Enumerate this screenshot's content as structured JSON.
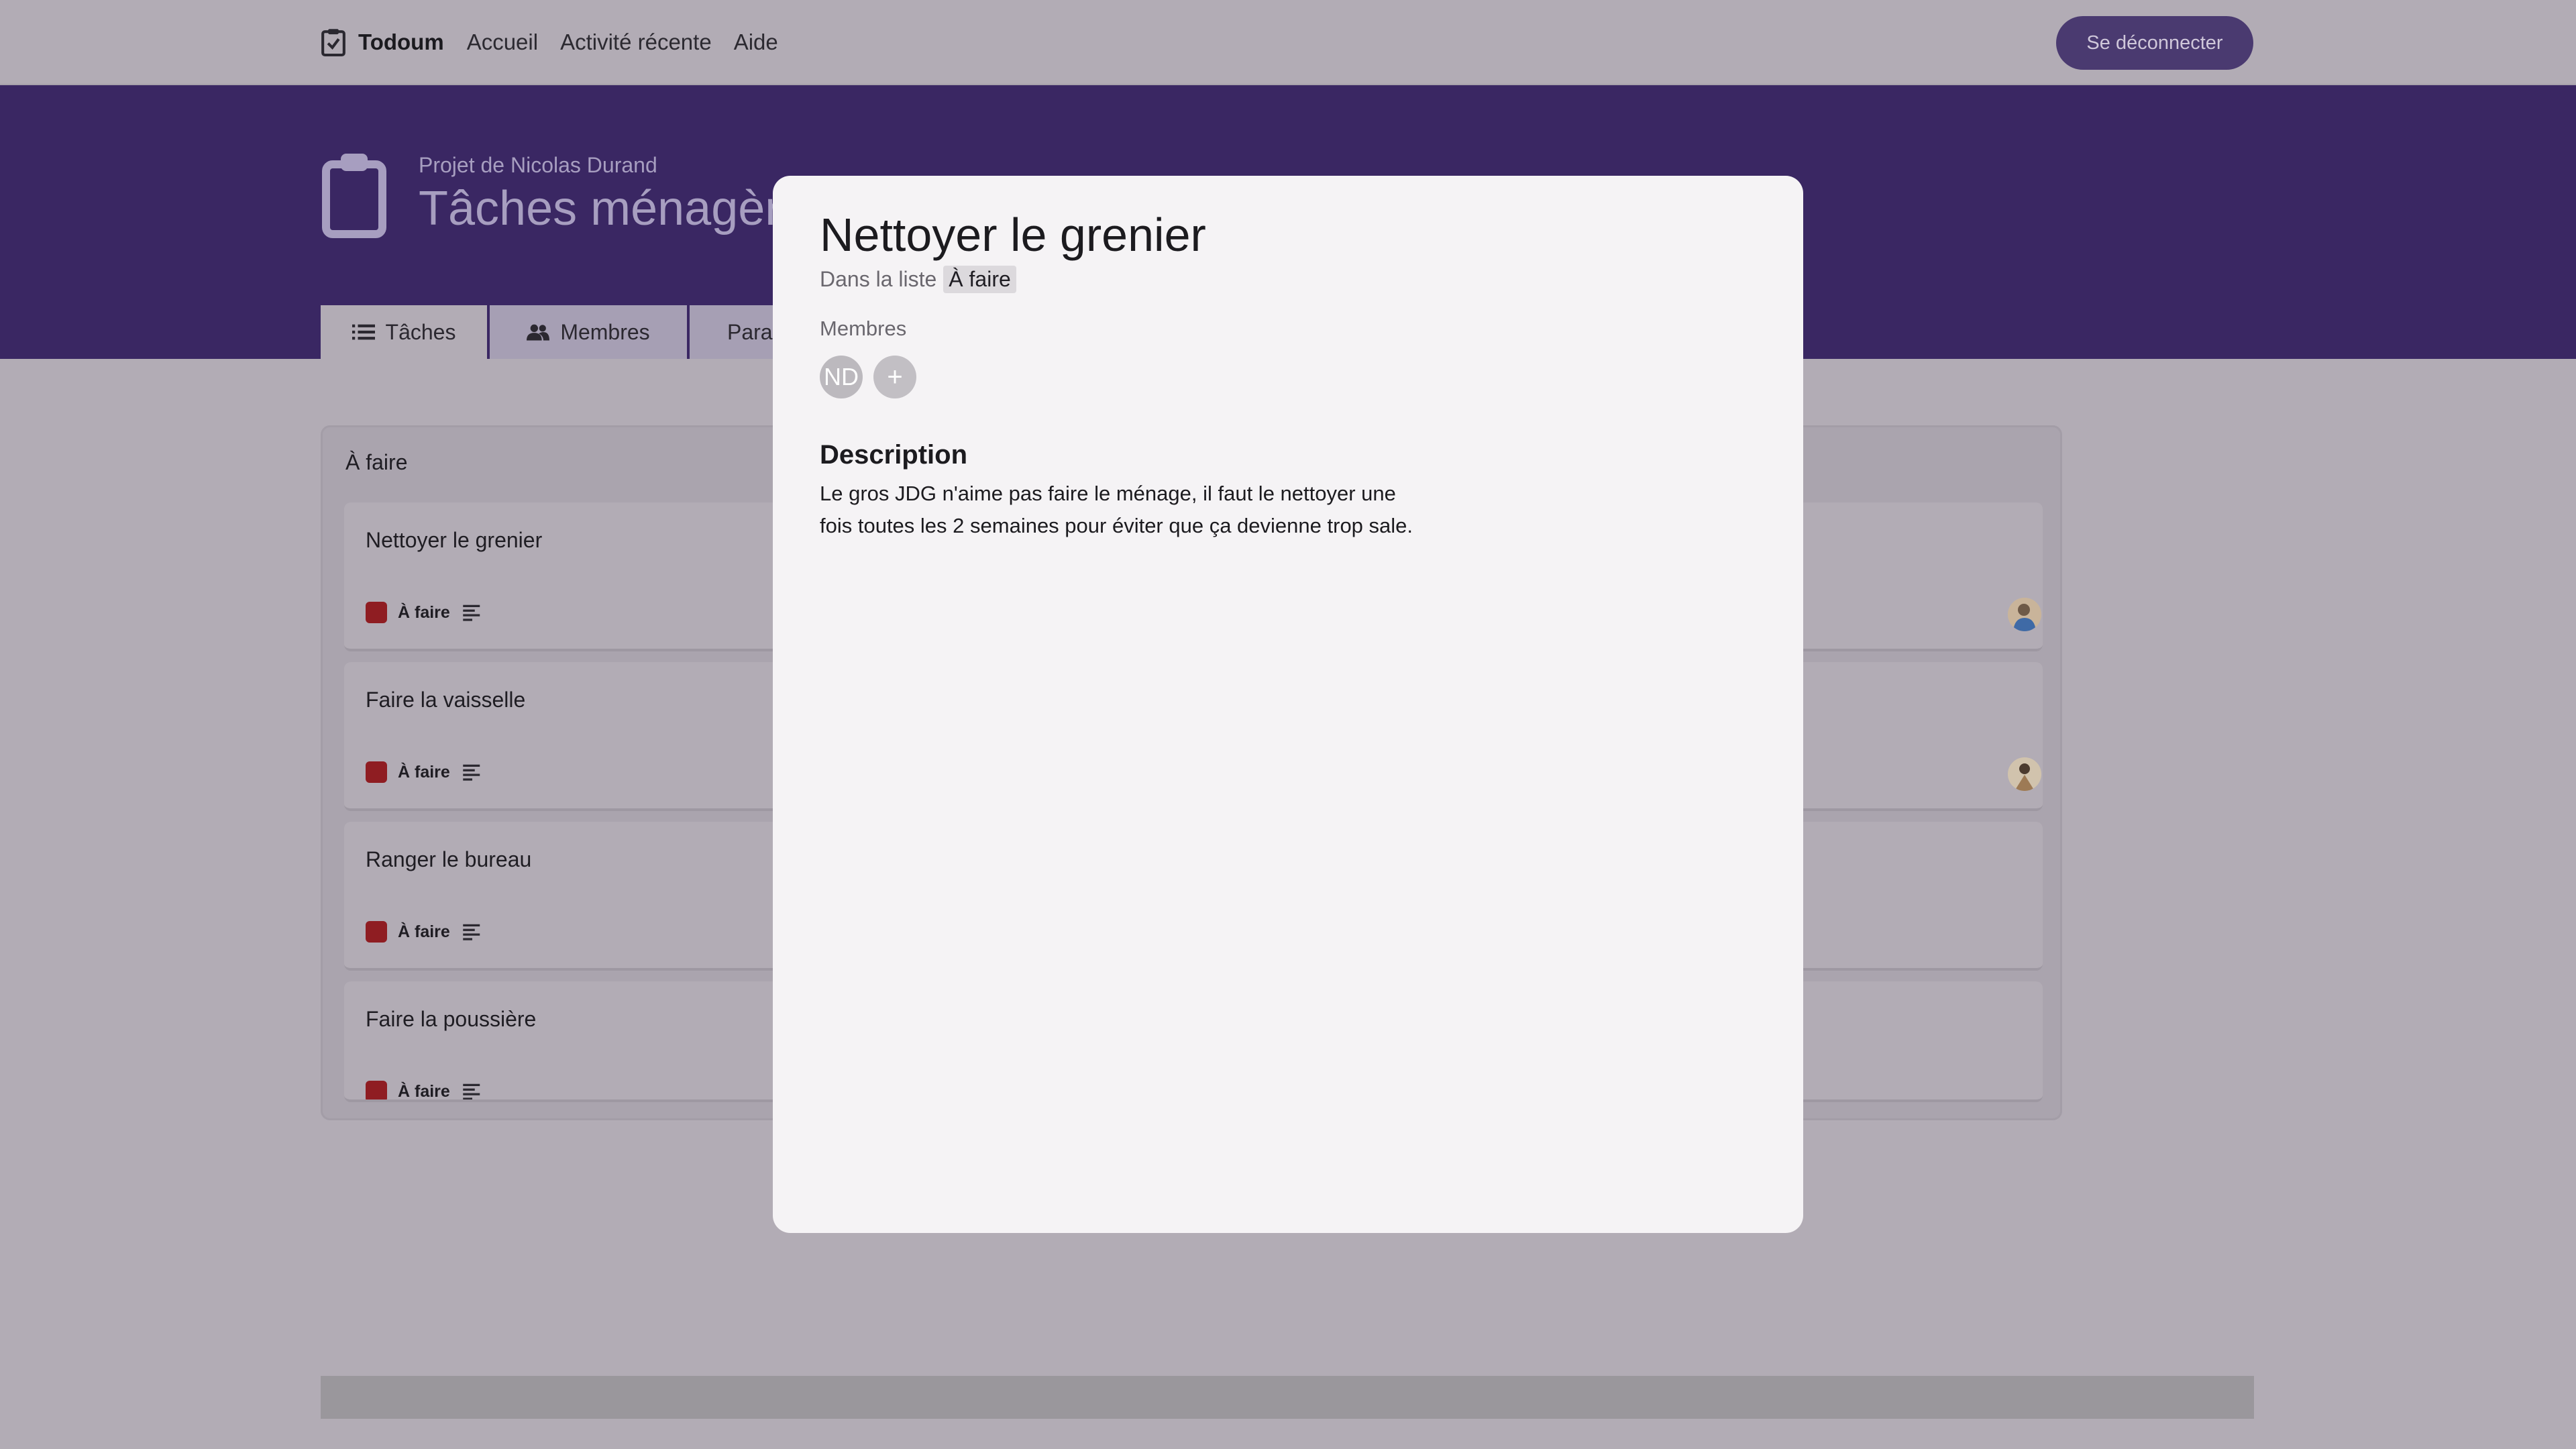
{
  "nav": {
    "brand": "Todoum",
    "links": [
      "Accueil",
      "Activité récente",
      "Aide"
    ],
    "logout_label": "Se déconnecter"
  },
  "project": {
    "subtitle": "Projet de Nicolas Durand",
    "title": "Tâches ménagères",
    "icon": "clipboard-icon"
  },
  "tabs": {
    "tasks": "Tâches",
    "members": "Membres",
    "params": "Paramètres"
  },
  "board": {
    "list_title": "À faire",
    "cards": [
      {
        "title": "Nettoyer le grenier",
        "status": "À faire"
      },
      {
        "title": "Faire la vaisselle",
        "status": "À faire"
      },
      {
        "title": "Ranger le bureau",
        "status": "À faire"
      },
      {
        "title": "Faire la poussière",
        "status": "À faire"
      }
    ],
    "status_color": "#8f1d22"
  },
  "modal": {
    "title": "Nettoyer le grenier",
    "in_list_prefix": "Dans la liste",
    "list_name": "À faire",
    "members_label": "Membres",
    "member_initials": "ND",
    "add_member_symbol": "+",
    "description_heading": "Description",
    "description": "Le gros JDG n'aime pas faire le ménage, il faut le nettoyer une fois toutes les 2 semaines pour éviter que ça devienne trop sale."
  },
  "colors": {
    "header_purple": "#3a2763",
    "logout_button": "#4a3a70",
    "overlay": "#b2acb5"
  }
}
